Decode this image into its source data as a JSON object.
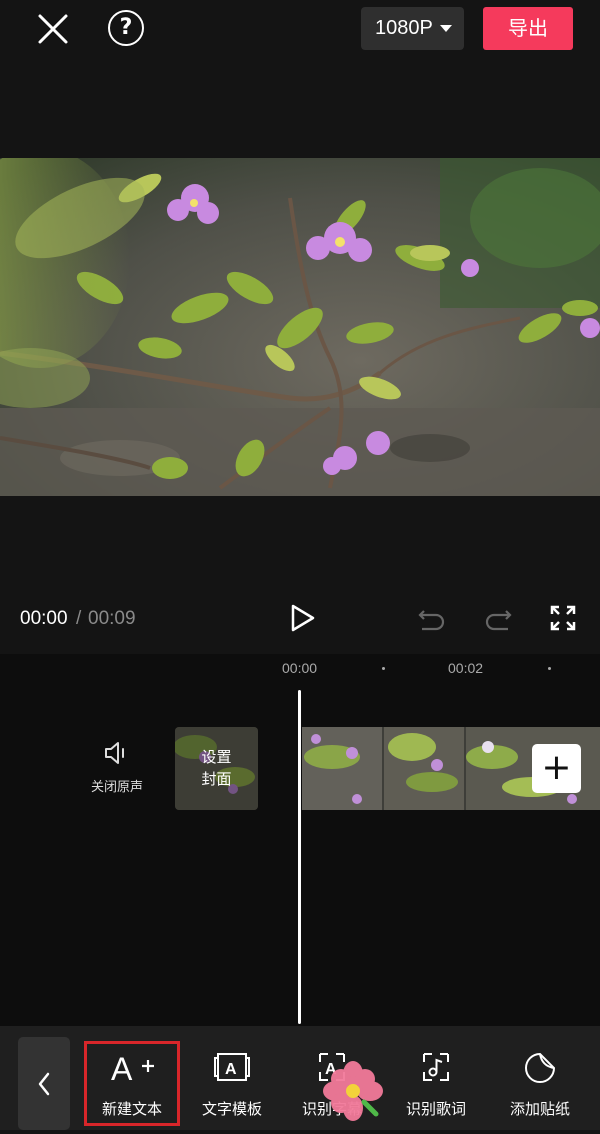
{
  "header": {
    "resolution_label": "1080P",
    "export_label": "导出",
    "help_symbol": "?"
  },
  "playback": {
    "current_time": "00:00",
    "separator": "/",
    "total_time": "00:09"
  },
  "timeline": {
    "ruler_ticks": [
      "00:00",
      "00:02"
    ],
    "audio_toggle_label": "关闭原声",
    "cover_label_line1": "设置",
    "cover_label_line2": "封面",
    "add_clip_symbol": "+"
  },
  "toolbar": {
    "back_symbol": "‹",
    "items": [
      {
        "label": "新建文本",
        "icon": "text-add-icon",
        "selected": true
      },
      {
        "label": "文字模板",
        "icon": "text-template-icon"
      },
      {
        "label": "识别字幕",
        "icon": "recognize-subtitle-icon"
      },
      {
        "label": "识别歌词",
        "icon": "recognize-lyrics-icon"
      },
      {
        "label": "添加贴纸",
        "icon": "sticker-icon"
      }
    ]
  },
  "colors": {
    "export_accent": "#f53a5c",
    "selection_outline": "#d8262a",
    "background": "#151515"
  }
}
